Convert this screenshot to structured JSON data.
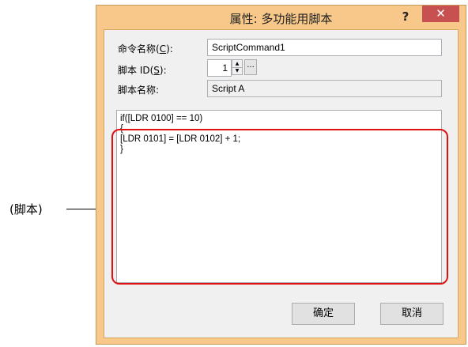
{
  "dialog": {
    "title": "属性: 多功能用脚本",
    "help_glyph": "?",
    "close_glyph": "✕"
  },
  "form": {
    "command_name": {
      "label_pre": "命令名称(",
      "label_key": "C",
      "label_post": "):",
      "value": "ScriptCommand1"
    },
    "script_id": {
      "label_pre": "脚本 ID(",
      "label_key": "S",
      "label_post": "):",
      "value": "1",
      "browse_label": "..."
    },
    "script_name": {
      "label": "脚本名称:",
      "value": "Script A"
    }
  },
  "script": {
    "text": "if([LDR 0100] == 10)\n{\n[LDR 0101] = [LDR 0102] + 1;\n}"
  },
  "buttons": {
    "ok": "确定",
    "cancel": "取消"
  },
  "callout": {
    "label": "(脚本)"
  }
}
